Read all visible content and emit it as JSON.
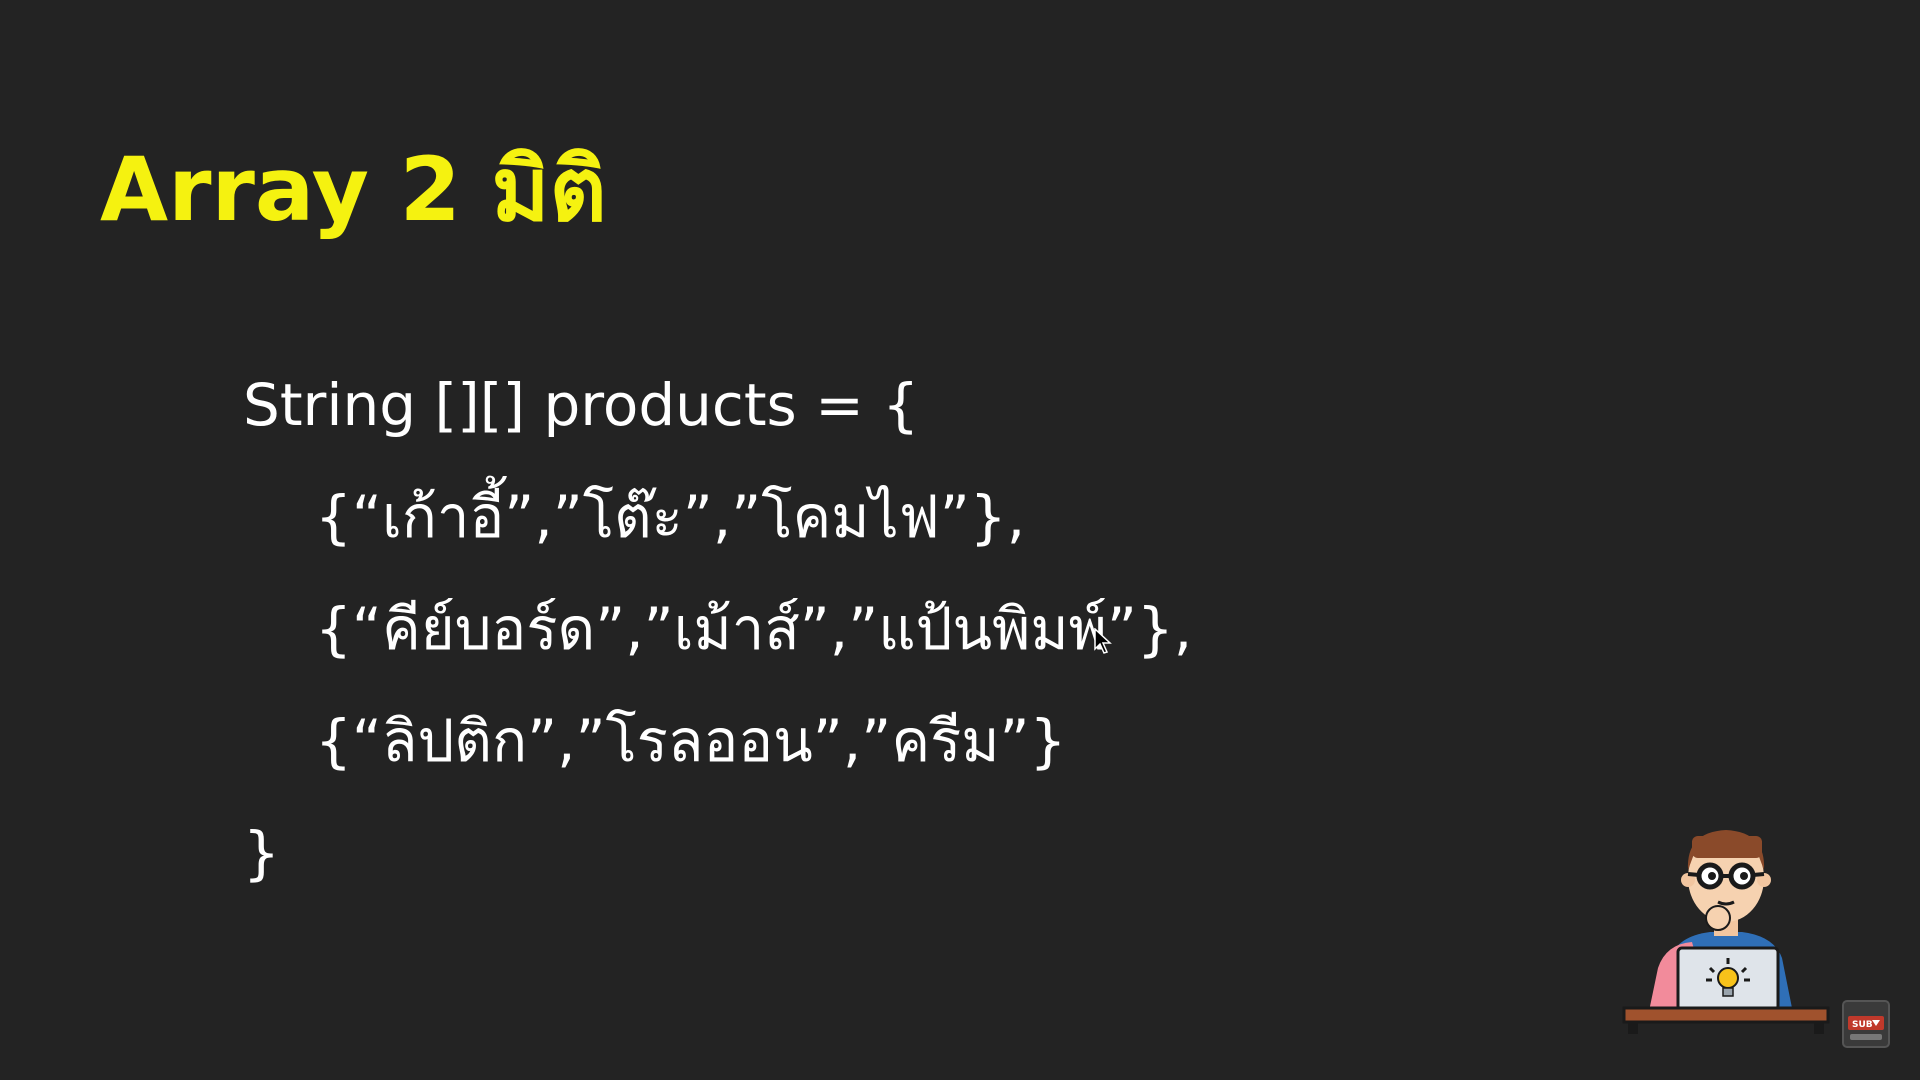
{
  "slide": {
    "title": "Array 2 มิติ",
    "code_lines": [
      "String [][] products = {",
      "{“เก้าอี้”,”โต๊ะ”,”โคมไฟ”},",
      "{“คีย์บอร์ด”,”เม้าส์”,”แป้นพิมพ์”},",
      "{“ลิปติก”,”โรลออน”,”ครีม”}",
      "}"
    ]
  },
  "overlay": {
    "mascot_icon": "programmer-thinking-icon",
    "sub_badge_text": "SUB",
    "cursor_icon": "mouse-pointer-icon"
  },
  "colors": {
    "background": "#232323",
    "title": "#f5f210",
    "code_text": "#ffffff"
  }
}
